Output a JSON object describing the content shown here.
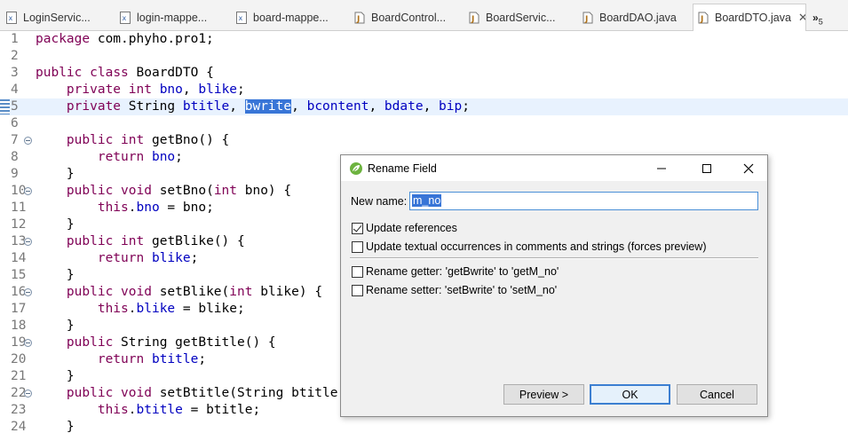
{
  "tabs": [
    {
      "label": "LoginServic...",
      "icon": "xml-file-icon",
      "active": false
    },
    {
      "label": "login-mappe...",
      "icon": "xml-file-icon",
      "active": false
    },
    {
      "label": "board-mappe...",
      "icon": "xml-file-icon",
      "active": false
    },
    {
      "label": "BoardControl...",
      "icon": "java-file-icon",
      "active": false
    },
    {
      "label": "BoardServic...",
      "icon": "java-file-icon",
      "active": false
    },
    {
      "label": "BoardDAO.java",
      "icon": "java-file-icon",
      "active": false
    },
    {
      "label": "BoardDTO.java",
      "icon": "java-file-icon",
      "active": true
    }
  ],
  "tab_overflow": {
    "glyph": "»",
    "count": "5"
  },
  "editor": {
    "lines": [
      {
        "n": "1",
        "segments": [
          {
            "t": "package",
            "c": "kw"
          },
          {
            "t": " com.phyho.pro1;"
          }
        ]
      },
      {
        "n": "2",
        "segments": []
      },
      {
        "n": "3",
        "segments": [
          {
            "t": "public",
            "c": "kw"
          },
          {
            "t": " "
          },
          {
            "t": "class",
            "c": "kw"
          },
          {
            "t": " BoardDTO {"
          }
        ]
      },
      {
        "n": "4",
        "segments": [
          {
            "t": "    "
          },
          {
            "t": "private",
            "c": "kw"
          },
          {
            "t": " "
          },
          {
            "t": "int",
            "c": "kw"
          },
          {
            "t": " "
          },
          {
            "t": "bno",
            "c": "fld"
          },
          {
            "t": ", "
          },
          {
            "t": "blike",
            "c": "fld"
          },
          {
            "t": ";"
          }
        ]
      },
      {
        "n": "5",
        "current": true,
        "marker": true,
        "segments": [
          {
            "t": "    "
          },
          {
            "t": "private",
            "c": "kw"
          },
          {
            "t": " String "
          },
          {
            "t": "btitle",
            "c": "fld"
          },
          {
            "t": ", "
          },
          {
            "t": "bwrite",
            "c": "sel"
          },
          {
            "t": ", "
          },
          {
            "t": "bcontent",
            "c": "fld"
          },
          {
            "t": ", "
          },
          {
            "t": "bdate",
            "c": "fld"
          },
          {
            "t": ", "
          },
          {
            "t": "bip",
            "c": "fld"
          },
          {
            "t": ";"
          }
        ]
      },
      {
        "n": "6",
        "segments": []
      },
      {
        "n": "7",
        "fold": true,
        "segments": [
          {
            "t": "    "
          },
          {
            "t": "public",
            "c": "kw"
          },
          {
            "t": " "
          },
          {
            "t": "int",
            "c": "kw"
          },
          {
            "t": " getBno() {"
          }
        ]
      },
      {
        "n": "8",
        "segments": [
          {
            "t": "        "
          },
          {
            "t": "return",
            "c": "kw"
          },
          {
            "t": " "
          },
          {
            "t": "bno",
            "c": "fld"
          },
          {
            "t": ";"
          }
        ]
      },
      {
        "n": "9",
        "segments": [
          {
            "t": "    }"
          }
        ]
      },
      {
        "n": "10",
        "fold": true,
        "segments": [
          {
            "t": "    "
          },
          {
            "t": "public",
            "c": "kw"
          },
          {
            "t": " "
          },
          {
            "t": "void",
            "c": "kw"
          },
          {
            "t": " setBno("
          },
          {
            "t": "int",
            "c": "kw"
          },
          {
            "t": " bno) {"
          }
        ]
      },
      {
        "n": "11",
        "segments": [
          {
            "t": "        "
          },
          {
            "t": "this",
            "c": "kw"
          },
          {
            "t": "."
          },
          {
            "t": "bno",
            "c": "fld"
          },
          {
            "t": " = bno;"
          }
        ]
      },
      {
        "n": "12",
        "segments": [
          {
            "t": "    }"
          }
        ]
      },
      {
        "n": "13",
        "fold": true,
        "segments": [
          {
            "t": "    "
          },
          {
            "t": "public",
            "c": "kw"
          },
          {
            "t": " "
          },
          {
            "t": "int",
            "c": "kw"
          },
          {
            "t": " getBlike() {"
          }
        ]
      },
      {
        "n": "14",
        "segments": [
          {
            "t": "        "
          },
          {
            "t": "return",
            "c": "kw"
          },
          {
            "t": " "
          },
          {
            "t": "blike",
            "c": "fld"
          },
          {
            "t": ";"
          }
        ]
      },
      {
        "n": "15",
        "segments": [
          {
            "t": "    }"
          }
        ]
      },
      {
        "n": "16",
        "fold": true,
        "segments": [
          {
            "t": "    "
          },
          {
            "t": "public",
            "c": "kw"
          },
          {
            "t": " "
          },
          {
            "t": "void",
            "c": "kw"
          },
          {
            "t": " setBlike("
          },
          {
            "t": "int",
            "c": "kw"
          },
          {
            "t": " blike) {"
          }
        ]
      },
      {
        "n": "17",
        "segments": [
          {
            "t": "        "
          },
          {
            "t": "this",
            "c": "kw"
          },
          {
            "t": "."
          },
          {
            "t": "blike",
            "c": "fld"
          },
          {
            "t": " = blike;"
          }
        ]
      },
      {
        "n": "18",
        "segments": [
          {
            "t": "    }"
          }
        ]
      },
      {
        "n": "19",
        "fold": true,
        "segments": [
          {
            "t": "    "
          },
          {
            "t": "public",
            "c": "kw"
          },
          {
            "t": " String getBtitle() {"
          }
        ]
      },
      {
        "n": "20",
        "segments": [
          {
            "t": "        "
          },
          {
            "t": "return",
            "c": "kw"
          },
          {
            "t": " "
          },
          {
            "t": "btitle",
            "c": "fld"
          },
          {
            "t": ";"
          }
        ]
      },
      {
        "n": "21",
        "segments": [
          {
            "t": "    }"
          }
        ]
      },
      {
        "n": "22",
        "fold": true,
        "segments": [
          {
            "t": "    "
          },
          {
            "t": "public",
            "c": "kw"
          },
          {
            "t": " "
          },
          {
            "t": "void",
            "c": "kw"
          },
          {
            "t": " setBtitle(String btitle) {"
          }
        ]
      },
      {
        "n": "23",
        "segments": [
          {
            "t": "        "
          },
          {
            "t": "this",
            "c": "kw"
          },
          {
            "t": "."
          },
          {
            "t": "btitle",
            "c": "fld"
          },
          {
            "t": " = btitle;"
          }
        ]
      },
      {
        "n": "24",
        "segments": [
          {
            "t": "    }"
          }
        ]
      }
    ]
  },
  "dialog": {
    "title": "Rename Field",
    "new_name_label": "New name:",
    "new_name_value": "m_no",
    "options": [
      {
        "label": "Update references",
        "checked": true
      },
      {
        "label": "Update textual occurrences in comments and strings (forces preview)",
        "checked": false
      }
    ],
    "accessor_options": [
      {
        "label": "Rename getter: 'getBwrite' to 'getM_no'",
        "checked": false
      },
      {
        "label": "Rename setter: 'setBwrite' to 'setM_no'",
        "checked": false
      }
    ],
    "preview_label": "Preview >",
    "ok_label": "OK",
    "cancel_label": "Cancel"
  },
  "colors": {
    "keyword": "#7f0055",
    "field": "#0000c0",
    "selection": "#3875d7",
    "current_line": "#e8f2fe",
    "default_button_border": "#3c7fd1"
  }
}
